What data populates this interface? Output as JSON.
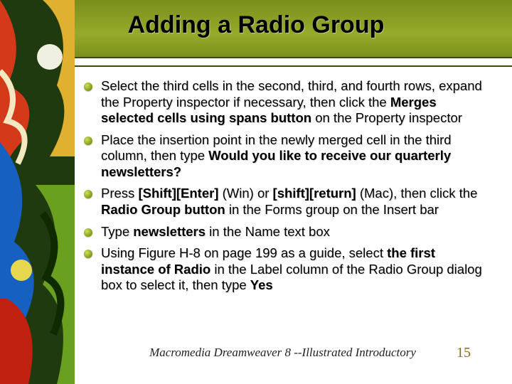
{
  "title": "Adding a Radio Group",
  "bullets": [
    {
      "segments": [
        {
          "t": "Select the third cells in the second, third, and fourth rows, expand the Property inspector if necessary, then click the ",
          "b": false
        },
        {
          "t": "Merges selected cells using spans button",
          "b": true
        },
        {
          "t": " on the Property inspector",
          "b": false
        }
      ]
    },
    {
      "segments": [
        {
          "t": "Place the insertion point in the newly merged cell in the third column, then type ",
          "b": false
        },
        {
          "t": "Would you like to receive our quarterly newsletters?",
          "b": true
        }
      ]
    },
    {
      "segments": [
        {
          "t": "Press ",
          "b": false
        },
        {
          "t": "[Shift][Enter]",
          "b": true
        },
        {
          "t": " (Win) or ",
          "b": false
        },
        {
          "t": "[shift][return]",
          "b": true
        },
        {
          "t": " (Mac), then click the ",
          "b": false
        },
        {
          "t": "Radio Group button",
          "b": true
        },
        {
          "t": " in the Forms group on the Insert bar",
          "b": false
        }
      ]
    },
    {
      "segments": [
        {
          "t": "Type ",
          "b": false
        },
        {
          "t": "newsletters",
          "b": true
        },
        {
          "t": " in the Name text box",
          "b": false
        }
      ]
    },
    {
      "segments": [
        {
          "t": "Using Figure H-8 on page 199 as a guide, select ",
          "b": false
        },
        {
          "t": "the first instance of Radio",
          "b": true
        },
        {
          "t": " in the Label column of the Radio Group dialog box to select it, then type ",
          "b": false
        },
        {
          "t": "Yes",
          "b": true
        }
      ]
    }
  ],
  "footer": "Macromedia Dreamweaver 8 --Illustrated Introductory",
  "page_number": "15"
}
